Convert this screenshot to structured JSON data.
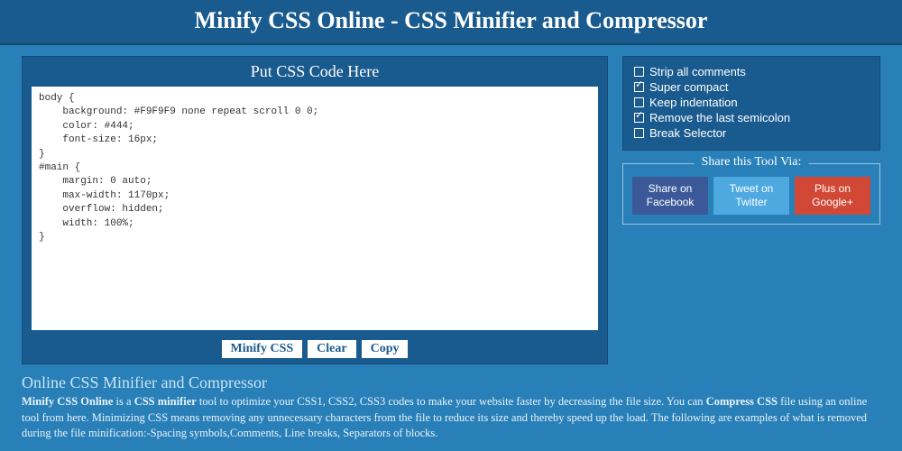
{
  "header": {
    "title": "Minify CSS Online - CSS Minifier and Compressor"
  },
  "panel": {
    "label": "Put CSS Code Here"
  },
  "code": "body {\n    background: #F9F9F9 none repeat scroll 0 0;\n    color: #444;\n    font-size: 16px;\n}\n#main {\n    margin: 0 auto;\n    max-width: 1170px;\n    overflow: hidden;\n    width: 100%;\n}",
  "actions": {
    "minify": "Minify CSS",
    "clear": "Clear",
    "copy": "Copy"
  },
  "options": [
    {
      "label": "Strip all comments",
      "checked": false
    },
    {
      "label": "Super compact",
      "checked": true
    },
    {
      "label": "Keep indentation",
      "checked": false
    },
    {
      "label": "Remove the last semicolon",
      "checked": true
    },
    {
      "label": "Break Selector",
      "checked": false
    }
  ],
  "share": {
    "title": "Share this Tool Via:",
    "fb": "Share on Facebook",
    "tw": "Tweet on Twitter",
    "gp": "Plus on Google+"
  },
  "desc": {
    "heading": "Online CSS Minifier and Compressor",
    "b1": "Minify CSS Online",
    "t1": " is a ",
    "b2": "CSS minifier",
    "t2": " tool to optimize your CSS1, CSS2, CSS3 codes to make your website faster by decreasing the file size. You can ",
    "b3": "Compress CSS",
    "t3": " file using an online tool from here. Minimizing CSS means removing any unnecessary characters from the file to reduce its size and thereby speed up the load. The following are examples of what is removed during the file minification:-Spacing symbols,Comments, Line breaks, Separators of blocks."
  }
}
